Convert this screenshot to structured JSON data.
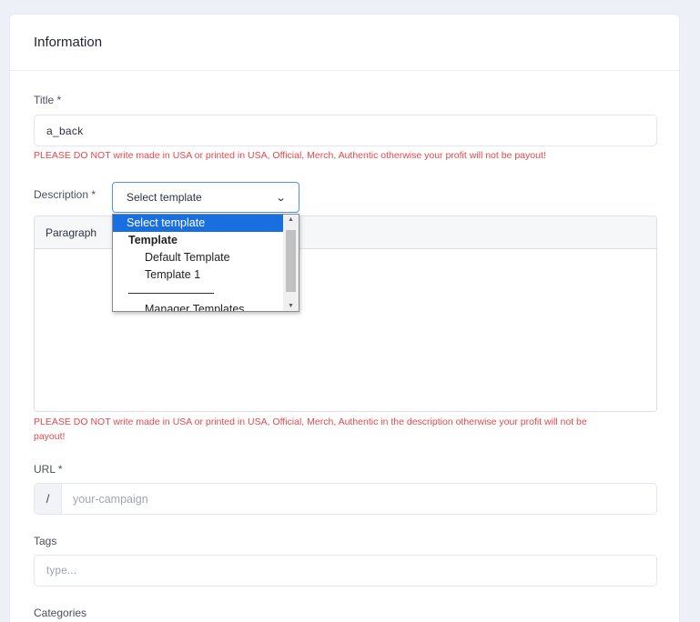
{
  "card": {
    "title": "Information"
  },
  "title_field": {
    "label": "Title *",
    "value": "a_back",
    "warning": "PLEASE DO NOT write made in USA or printed in USA, Official, Merch, Authentic otherwise your profit will not be payout!"
  },
  "description": {
    "label": "Description *",
    "template_select": {
      "selected": "Select template",
      "chevron_icon": "chevron-down-icon",
      "options": {
        "placeholder": "Select template",
        "group_label": "Template",
        "items": [
          "Default Template",
          "Template 1"
        ],
        "manage": "Manager Templates"
      }
    },
    "editor": {
      "format_select": "Paragraph",
      "content": ""
    },
    "warning": "PLEASE DO NOT write made in USA or printed in USA, Official, Merch, Authentic in the description otherwise your profit will not be",
    "warning_cont": "payout!"
  },
  "url_field": {
    "label": "URL *",
    "prefix": "/",
    "placeholder": "your-campaign"
  },
  "tags_field": {
    "label": "Tags",
    "placeholder": "type..."
  },
  "categories_field": {
    "label": "Categories"
  },
  "colors": {
    "warning": "#e5484d",
    "selected": "#1a6fe0",
    "focus_border": "#4d90fe",
    "background": "#eef0f7"
  }
}
